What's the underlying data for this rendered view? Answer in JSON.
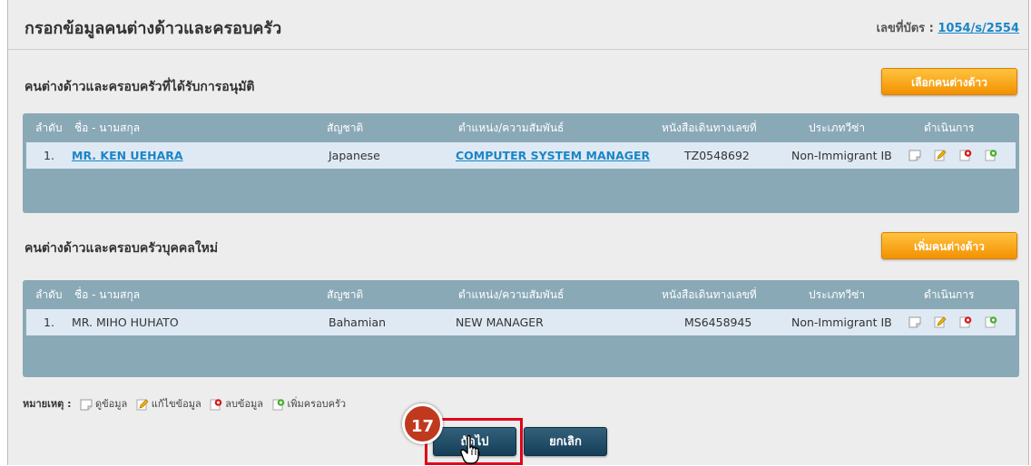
{
  "header": {
    "title": "กรอกข้อมูลคนต่างด้าวและครอบครัว",
    "card_label": "เลขที่บัตร :",
    "card_number": "1054/s/2554"
  },
  "approved_section": {
    "title": "คนต่างด้าวและครอบครัวที่ได้รับการอนุมัติ",
    "button_label": "เลือกคนต่างด้าว",
    "columns": [
      "ลำดับ",
      "ชื่อ - นามสกุล",
      "สัญชาติ",
      "ตำแหน่ง/ความสัมพันธ์",
      "หนังสือเดินทางเลขที่",
      "ประเภทวีซ่า",
      "ดำเนินการ"
    ],
    "rows": [
      {
        "index": "1.",
        "name": "MR. KEN UEHARA",
        "nationality": "Japanese",
        "position": "COMPUTER SYSTEM MANAGER",
        "passport": "TZ0548692",
        "visa": "Non-Immigrant IB"
      }
    ]
  },
  "new_section": {
    "title": "คนต่างด้าวและครอบครัวบุคคลใหม่",
    "button_label": "เพิ่มคนต่างด้าว",
    "columns": [
      "ลำดับ",
      "ชื่อ - นามสกุล",
      "สัญชาติ",
      "ตำแหน่ง/ความสัมพันธ์",
      "หนังสือเดินทางเลขที่",
      "ประเภทวีซ่า",
      "ดำเนินการ"
    ],
    "rows": [
      {
        "index": "1.",
        "name": "MR. MIHO HUHATO",
        "nationality": "Bahamian",
        "position": "NEW MANAGER",
        "passport": "MS6458945",
        "visa": "Non-Immigrant IB"
      }
    ]
  },
  "legend": {
    "label": "หมายเหตุ :",
    "view": "ดูข้อมูล",
    "edit": "แก้ไขข้อมูล",
    "delete": "ลบข้อมูล",
    "add_family": "เพิ่มครอบครัว"
  },
  "footer": {
    "next_label": "ถัดไป",
    "cancel_label": "ยกเลิก",
    "step_number": "17"
  },
  "colors": {
    "accent_orange": "#f39100",
    "link_blue": "#1a86c8",
    "table_header": "#8aa9b7",
    "row_bg": "#dfe9f4",
    "button_dark": "#163f58",
    "highlight_red": "#e3001b"
  },
  "icons": [
    "view-icon",
    "edit-icon",
    "delete-icon",
    "add-family-icon",
    "hand-cursor-icon"
  ]
}
